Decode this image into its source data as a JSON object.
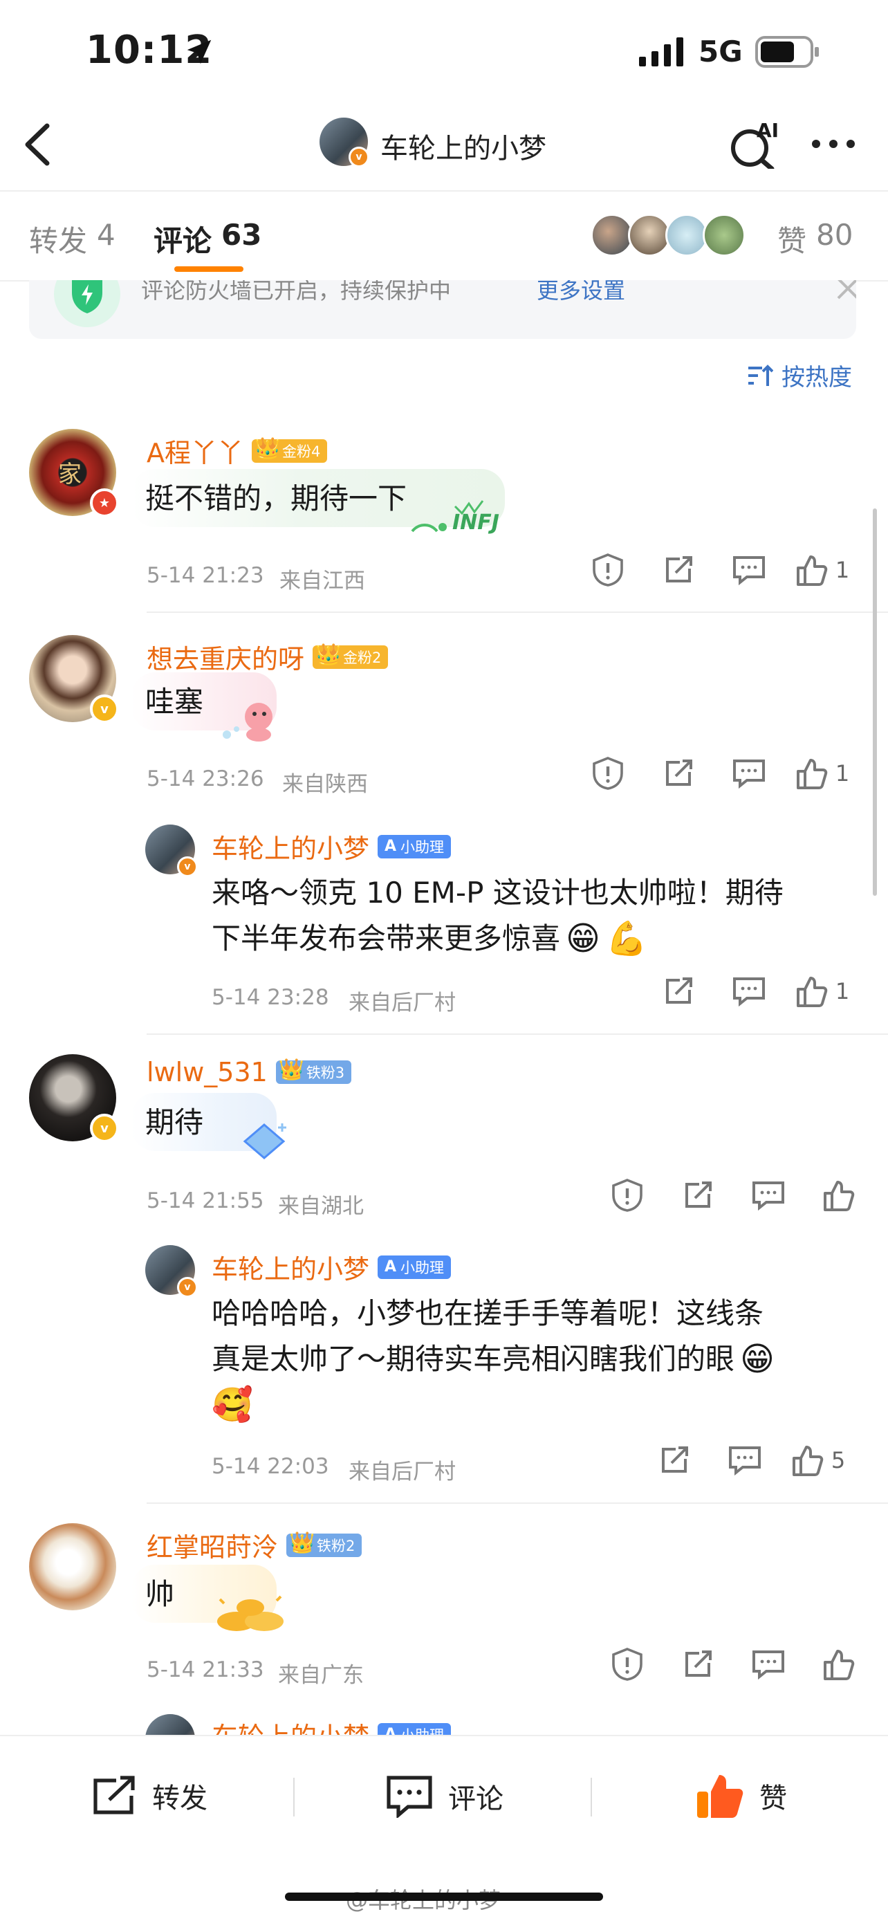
{
  "status": {
    "time": "10:12",
    "network": "5G"
  },
  "nav": {
    "title": "车轮上的小梦",
    "ai_label": "AI"
  },
  "tabs": {
    "repost": {
      "label": "转发",
      "count": "4"
    },
    "comment": {
      "label": "评论",
      "count": "63"
    },
    "likes": {
      "label": "赞",
      "count": "80"
    }
  },
  "notice": {
    "text": "评论防火墙已开启，持续保护中",
    "link": "更多设置"
  },
  "sort": {
    "label": "按热度"
  },
  "comments": [
    {
      "user": "A程丫丫",
      "badge": "金粉4",
      "text": "挺不错的，期待一下",
      "sticker_text": "INFJ",
      "time": "5-14 21:23",
      "location": "来自江西",
      "likes": "1"
    },
    {
      "user": "想去重庆的呀",
      "badge": "金粉2",
      "text": "哇塞",
      "time": "5-14 23:26",
      "location": "来自陕西",
      "likes": "1",
      "reply": {
        "user": "车轮上的小梦",
        "badge": "小助理",
        "text_line1": "来咯～领克 10 EM-P 这设计也太帅啦！期待",
        "text_line2": "下半年发布会带来更多惊喜",
        "time": "5-14 23:28",
        "location": "来自后厂村",
        "likes": "1"
      }
    },
    {
      "user": "lwlw_531",
      "badge": "铁粉3",
      "text": "期待",
      "time": "5-14 21:55",
      "location": "来自湖北",
      "likes": "",
      "reply": {
        "user": "车轮上的小梦",
        "badge": "小助理",
        "text_line1": "哈哈哈哈，小梦也在搓手手等着呢！这线条",
        "text_line2": "真是太帅了～期待实车亮相闪瞎我们的眼",
        "time": "5-14 22:03",
        "location": "来自后厂村",
        "likes": "5"
      }
    },
    {
      "user": "红掌昭莳泠",
      "badge": "铁粉2",
      "text": "帅",
      "time": "5-14 21:33",
      "location": "来自广东",
      "likes": "",
      "reply": {
        "user": "车轮上的小梦",
        "badge": "小助理"
      }
    }
  ],
  "bottom": {
    "repost": "转发",
    "comment": "评论",
    "like": "赞"
  },
  "watermark": "@车轮上的小梦",
  "colors": {
    "accent": "#ff8200",
    "username": "#ea6a12",
    "link": "#3d74c4",
    "gold_badge": "#f7b52d",
    "iron_badge": "#73a8e8",
    "ai_badge": "#4f8ef7"
  }
}
